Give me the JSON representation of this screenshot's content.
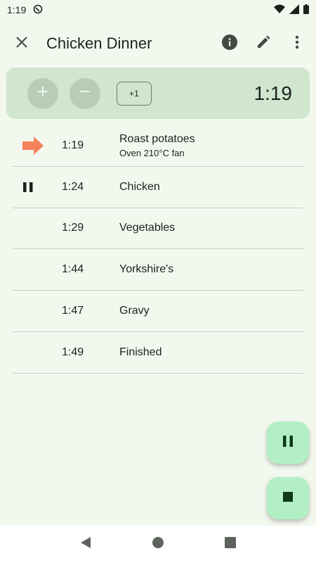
{
  "status": {
    "time": "1:19"
  },
  "header": {
    "title": "Chicken Dinner"
  },
  "controls": {
    "plus_one_label": "+1",
    "elapsed": "1:19"
  },
  "steps": [
    {
      "time": "1:19",
      "name": "Roast potatoes",
      "note": "Oven 210°C fan",
      "indicator": "arrow-right"
    },
    {
      "time": "1:24",
      "name": "Chicken",
      "note": "",
      "indicator": "pause"
    },
    {
      "time": "1:29",
      "name": "Vegetables",
      "note": "",
      "indicator": ""
    },
    {
      "time": "1:44",
      "name": "Yorkshire's",
      "note": "",
      "indicator": ""
    },
    {
      "time": "1:47",
      "name": "Gravy",
      "note": "",
      "indicator": ""
    },
    {
      "time": "1:49",
      "name": "Finished",
      "note": "",
      "indicator": ""
    }
  ],
  "colors": {
    "accent_arrow": "#f4825a",
    "card": "#d0e6cf",
    "fab": "#b3efc4",
    "background": "#f3f8ef"
  }
}
